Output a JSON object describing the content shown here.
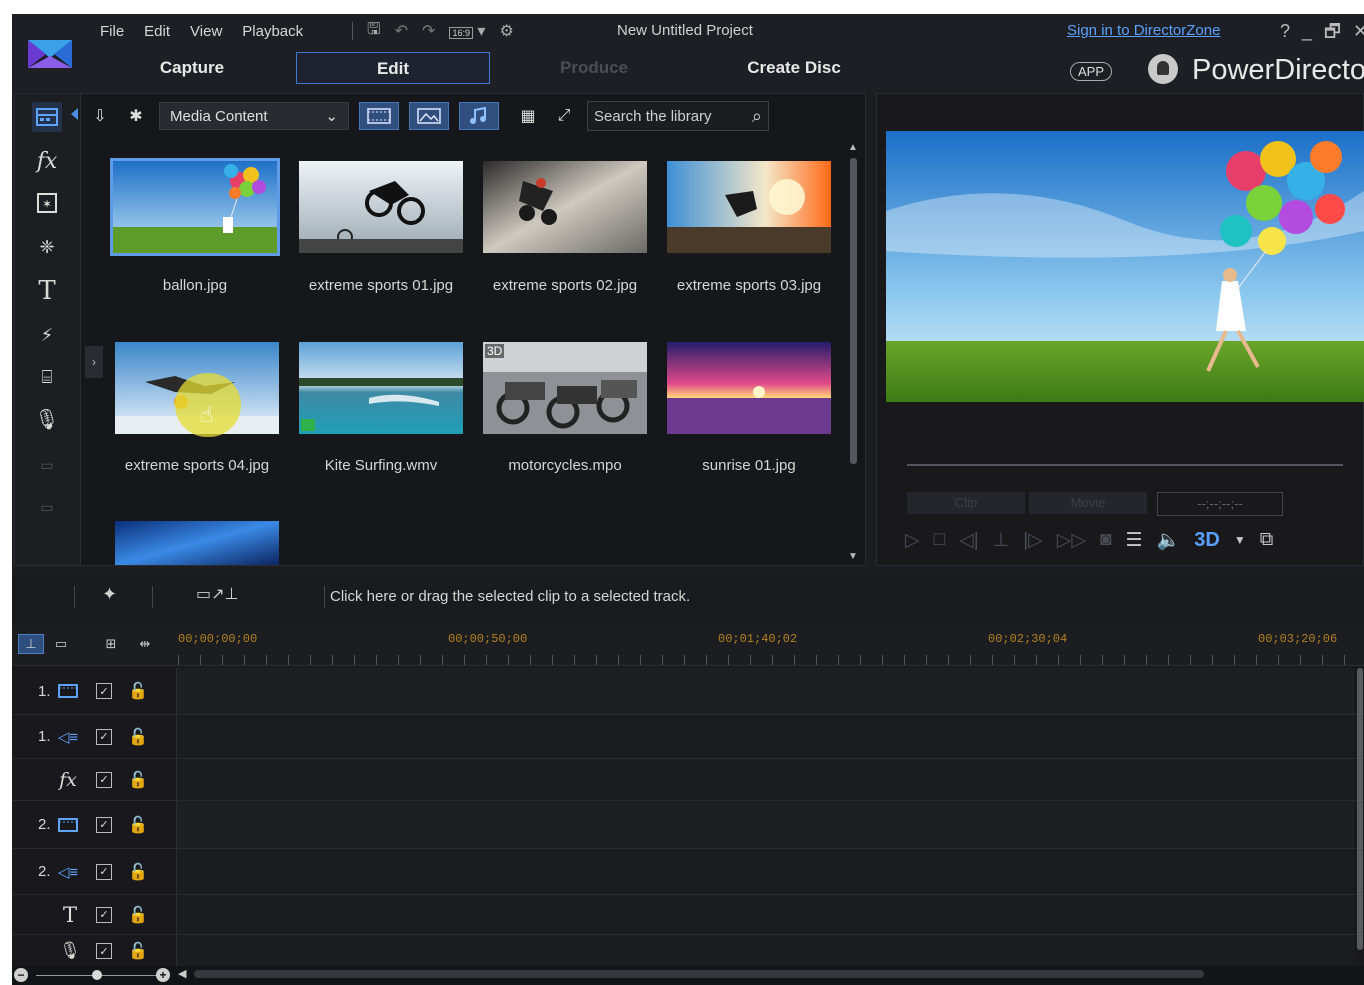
{
  "menu": [
    "File",
    "Edit",
    "View",
    "Playback"
  ],
  "toolbar": {
    "aspect": "16:9",
    "project_title": "New Untitled Project",
    "sign_in": "Sign in to DirectorZone",
    "window_controls": [
      "?",
      "_",
      "🗗",
      "✕"
    ]
  },
  "modes": {
    "capture": "Capture",
    "edit": "Edit",
    "produce": "Produce",
    "create_disc": "Create Disc"
  },
  "brand": {
    "app_badge": "APP",
    "name": "PowerDirector"
  },
  "library": {
    "dropdown": "Media Content",
    "search_placeholder": "Search the library",
    "items": [
      {
        "label": "ballon.jpg"
      },
      {
        "label": "extreme sports 01.jpg"
      },
      {
        "label": "extreme sports 02.jpg"
      },
      {
        "label": "extreme sports 03.jpg"
      },
      {
        "label": "extreme sports 04.jpg"
      },
      {
        "label": "Kite Surfing.wmv"
      },
      {
        "label": "motorcycles.mpo",
        "badge": "3D"
      },
      {
        "label": "sunrise 01.jpg"
      }
    ]
  },
  "preview": {
    "mode_clip": "Clip",
    "mode_movie": "Movie",
    "timecode": "--;--;--;--",
    "three_d": "3D"
  },
  "hint": "Click here or drag the selected clip to a selected track.",
  "timeline": {
    "ruler": [
      "00;00;00;00",
      "00;00;50;00",
      "00;01;40;02",
      "00;02;30;04",
      "00;03;20;06"
    ],
    "tracks": [
      {
        "num": "1.",
        "type": "video"
      },
      {
        "num": "1.",
        "type": "audio"
      },
      {
        "num": "",
        "type": "fx"
      },
      {
        "num": "2.",
        "type": "video"
      },
      {
        "num": "2.",
        "type": "audio"
      },
      {
        "num": "",
        "type": "title"
      },
      {
        "num": "",
        "type": "voice"
      }
    ]
  },
  "colors": {
    "accent": "#3d7bd0",
    "link": "#5aa2ff",
    "ruler": "#b3801f"
  }
}
